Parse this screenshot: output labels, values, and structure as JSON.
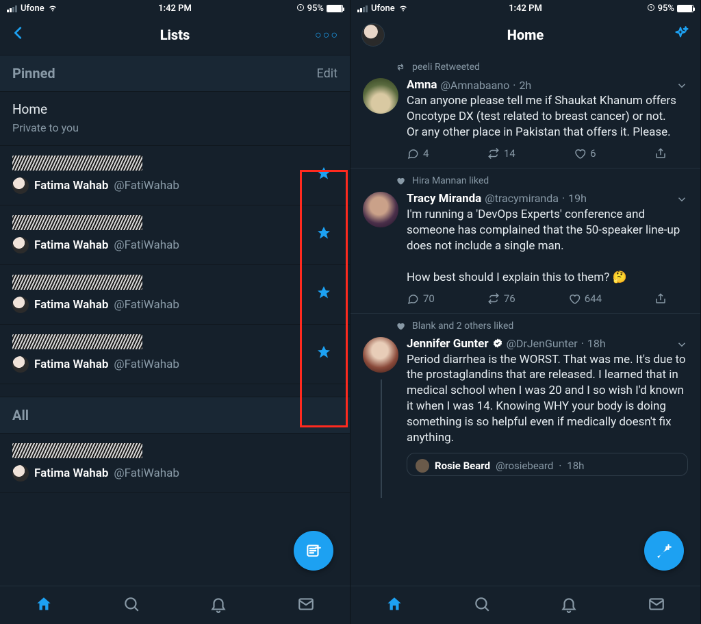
{
  "status": {
    "carrier": "Ufone",
    "time": "1:42 PM",
    "battery_pct": "95%"
  },
  "left": {
    "nav_title": "Lists",
    "sections": {
      "pinned": {
        "title": "Pinned",
        "edit": "Edit"
      },
      "all": {
        "title": "All"
      }
    },
    "home_list": {
      "name": "Home",
      "subtitle": "Private to you"
    },
    "owner": {
      "name": "Fatima Wahab",
      "handle": "@FatiWahab"
    }
  },
  "right": {
    "nav_title": "Home",
    "tweets": [
      {
        "context_icon": "retweet",
        "context": "peeli Retweeted",
        "name": "Amna",
        "handle": "@Amnabaano",
        "time": "2h",
        "text": "Can anyone please tell me if Shaukat Khanum offers Oncotype DX (test related to breast cancer) or not.\nOr any other place in Pakistan that offers it. Please.",
        "replies": "4",
        "retweets": "14",
        "likes": "6"
      },
      {
        "context_icon": "like",
        "context": "Hira Mannan liked",
        "name": "Tracy Miranda",
        "handle": "@tracymiranda",
        "time": "19h",
        "text": "I'm running a 'DevOps Experts' conference and someone has complained that the 50-speaker line-up does not include a single man.\n\nHow best should I explain this to them? 🤔",
        "replies": "70",
        "retweets": "76",
        "likes": "644"
      },
      {
        "context_icon": "like",
        "context": "Blank and 2 others liked",
        "name": "Jennifer Gunter",
        "verified": true,
        "handle": "@DrJenGunter",
        "time": "18h",
        "text": "Period diarrhea is the WORST. That was me. It's due to the prostaglandins that are released. I learned that in medical school when I was 20 and I so wish I'd known it when I was 14. Knowing WHY your body is doing something is so helpful even if medically doesn't fix anything.",
        "quoted": {
          "name": "Rosie Beard",
          "handle": "@rosiebeard",
          "time": "18h"
        }
      }
    ]
  }
}
